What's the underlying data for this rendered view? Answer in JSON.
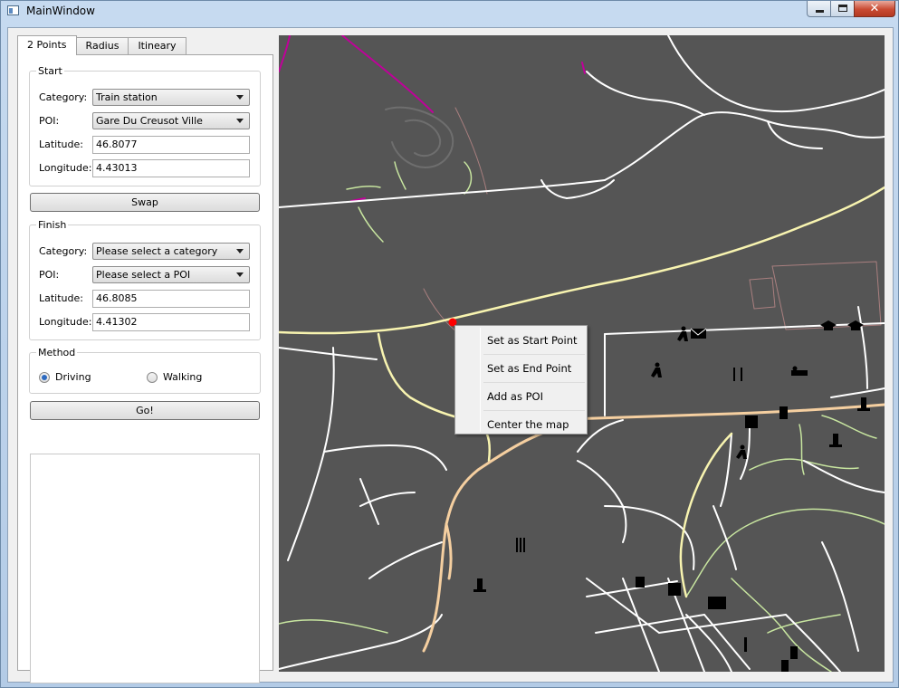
{
  "window": {
    "title": "MainWindow"
  },
  "tabs": [
    {
      "label": "2 Points"
    },
    {
      "label": "Radius"
    },
    {
      "label": "Itineary"
    }
  ],
  "start": {
    "title": "Start",
    "category_label": "Category:",
    "category_value": "Train station",
    "poi_label": "POI:",
    "poi_value": "Gare Du Creusot Ville",
    "latitude_label": "Latitude:",
    "latitude_value": "46.8077",
    "longitude_label": "Longitude:",
    "longitude_value": "4.43013"
  },
  "swap_label": "Swap",
  "finish": {
    "title": "Finish",
    "category_label": "Category:",
    "category_value": "Please select a category",
    "poi_label": "POI:",
    "poi_value": "Please select a POI",
    "latitude_label": "Latitude:",
    "latitude_value": "46.8085",
    "longitude_label": "Longitude:",
    "longitude_value": "4.41302"
  },
  "method": {
    "title": "Method",
    "options": [
      {
        "label": "Driving",
        "selected": true
      },
      {
        "label": "Walking",
        "selected": false
      }
    ]
  },
  "go_label": "Go!",
  "context_menu": {
    "items": [
      {
        "label": "Set as Start Point"
      },
      {
        "label": "Set as End Point"
      },
      {
        "label": "Add as POI"
      },
      {
        "label": "Center the map"
      }
    ]
  },
  "map": {
    "background_color": "#555555",
    "marker_color": "#ff0000",
    "road_colors": {
      "minor": "#ffffff",
      "secondary": "#f8f4b0",
      "primary": "#f5cfa0",
      "tertiary": "#c8e6a0",
      "path": "#c0009a"
    },
    "icons": [
      "pedestrian-icon",
      "mail-icon",
      "graduation-icon",
      "restaurant-icon",
      "hotel-icon",
      "cemetery-icon",
      "waste-icon"
    ]
  }
}
